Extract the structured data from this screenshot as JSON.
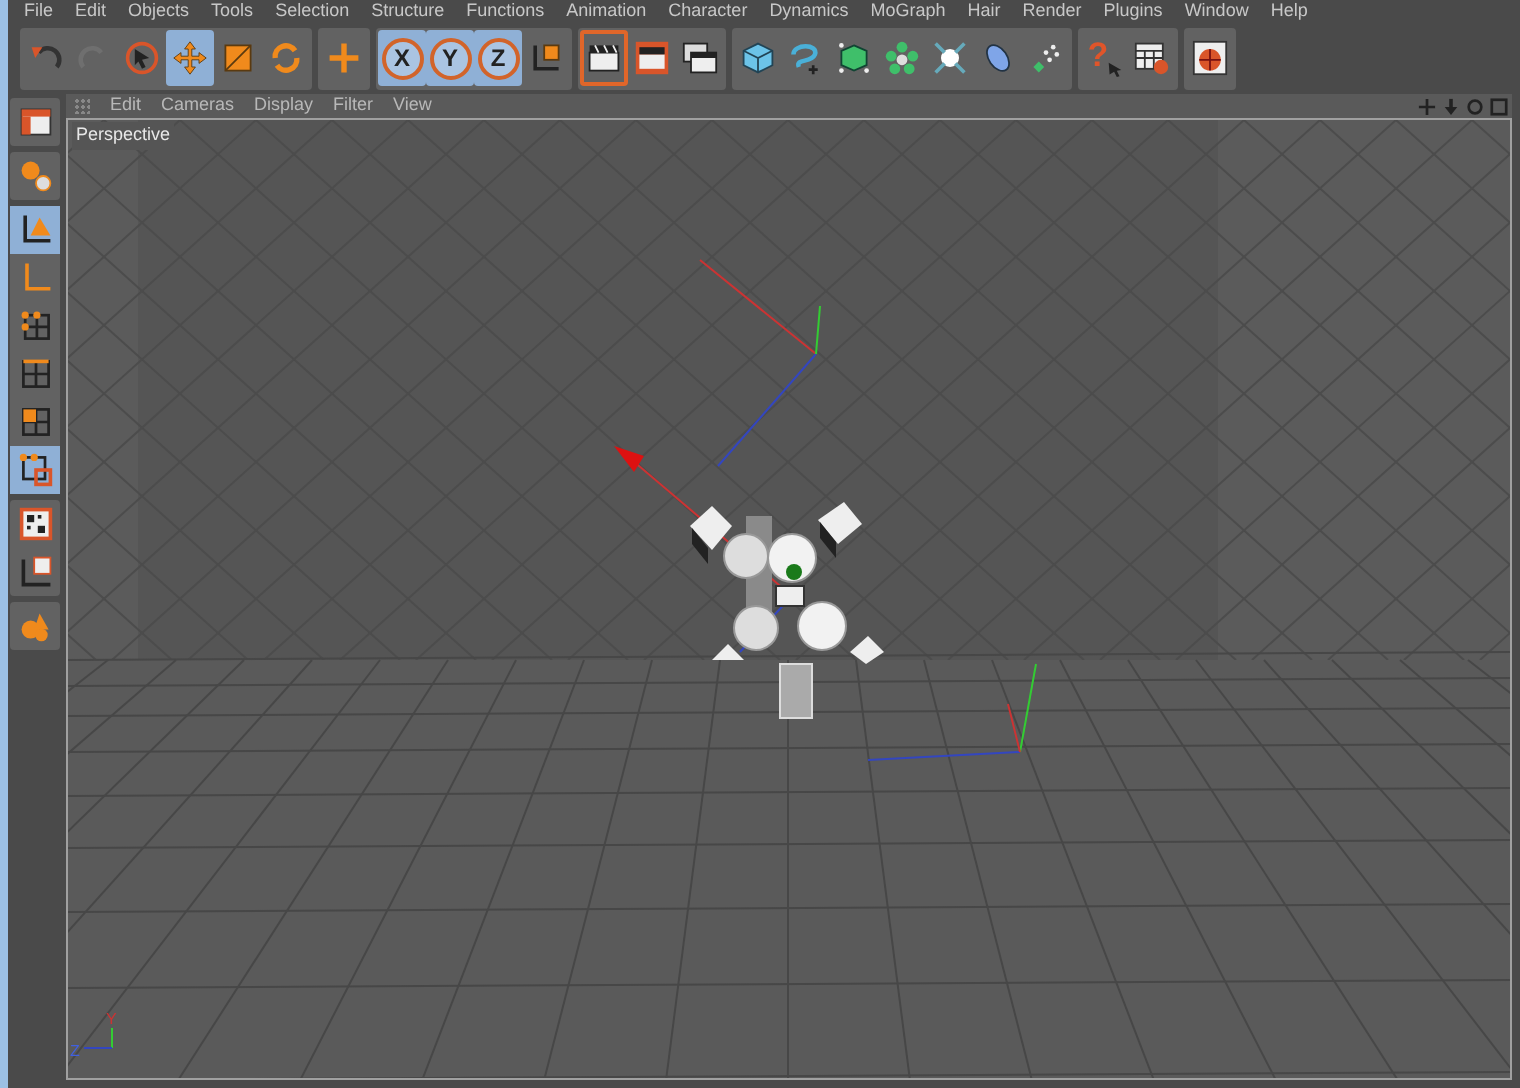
{
  "menu_bar": [
    "File",
    "Edit",
    "Objects",
    "Tools",
    "Selection",
    "Structure",
    "Functions",
    "Animation",
    "Character",
    "Dynamics",
    "MoGraph",
    "Hair",
    "Render",
    "Plugins",
    "Window",
    "Help"
  ],
  "toolbar": {
    "groups": [
      [
        {
          "selected": false,
          "disabled": false
        },
        {
          "selected": false,
          "disabled": true
        },
        {
          "selected": false,
          "disabled": false
        },
        {
          "selected": true,
          "disabled": false
        },
        {
          "selected": false,
          "disabled": false
        },
        {
          "selected": false,
          "disabled": false
        }
      ],
      [
        {
          "selected": false,
          "disabled": false
        }
      ],
      [
        {
          "label": "X",
          "selected": true,
          "disabled": false
        },
        {
          "label": "Y",
          "selected": true,
          "disabled": false
        },
        {
          "label": "Z",
          "selected": true,
          "disabled": false
        },
        {
          "selected": false,
          "disabled": false
        }
      ],
      [
        {
          "selected": true,
          "disabled": false
        },
        {
          "selected": false,
          "disabled": false
        },
        {
          "selected": false,
          "disabled": false
        }
      ],
      [
        {
          "selected": false,
          "disabled": false
        },
        {
          "selected": false,
          "disabled": false
        },
        {
          "selected": false,
          "disabled": false
        },
        {
          "selected": false,
          "disabled": false
        },
        {
          "selected": false,
          "disabled": false
        },
        {
          "selected": false,
          "disabled": false
        },
        {
          "selected": false,
          "disabled": false
        }
      ],
      [
        {
          "glyph": "?",
          "selected": false,
          "disabled": false
        },
        {
          "selected": false,
          "disabled": false
        }
      ],
      [
        {
          "selected": false,
          "disabled": false
        }
      ]
    ]
  },
  "mode_bar": {
    "groups": [
      [
        {
          "selected": false
        }
      ],
      [
        {
          "selected": false
        }
      ],
      [
        {
          "selected": true
        },
        {
          "selected": false
        },
        {
          "selected": false
        },
        {
          "selected": false
        },
        {
          "selected": false
        },
        {
          "selected": true
        }
      ],
      [
        {
          "selected": false
        },
        {
          "selected": false
        }
      ],
      [
        {
          "selected": false
        }
      ]
    ]
  },
  "viewport": {
    "menu": [
      "Edit",
      "Cameras",
      "Display",
      "Filter",
      "View"
    ],
    "view_name": "Perspective",
    "axis_labels": [
      "Y",
      "Z"
    ]
  }
}
